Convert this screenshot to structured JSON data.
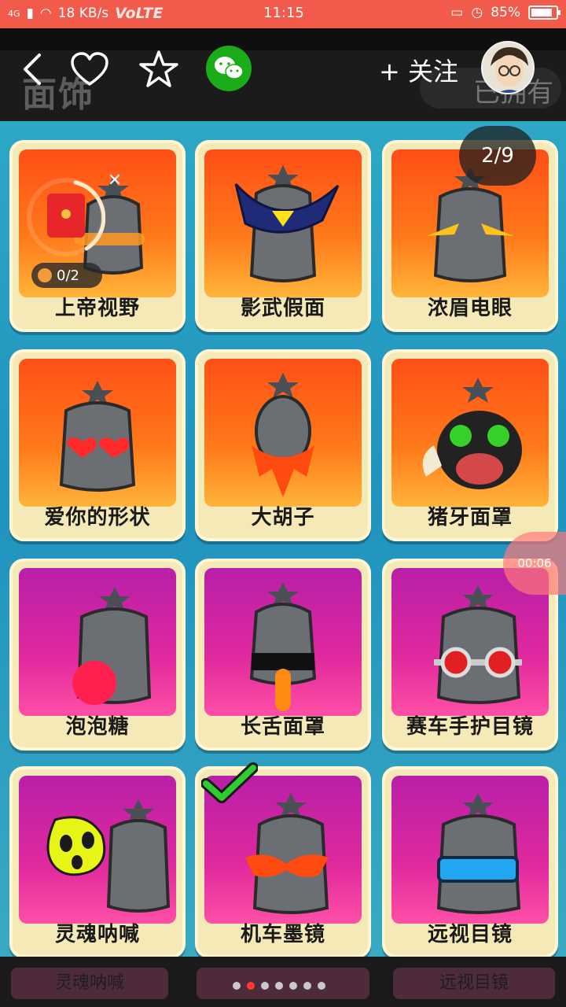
{
  "status_bar": {
    "network": "4G",
    "speed": "18 KB/s",
    "volte": "VoLTE",
    "time": "11:15",
    "battery": "85%"
  },
  "header": {
    "blurred_title": "面饰",
    "blurred_pill": "已拥有",
    "follow_label": "+ 关注"
  },
  "page_badge": "2/9",
  "timer": "00:06",
  "redpacket": {
    "counter": "0/2"
  },
  "items": [
    {
      "label": "上帝视野",
      "theme": "orange"
    },
    {
      "label": "影武假面",
      "theme": "orange"
    },
    {
      "label": "浓眉电眼",
      "theme": "orange"
    },
    {
      "label": "爱你的形状",
      "theme": "orange"
    },
    {
      "label": "大胡子",
      "theme": "orange"
    },
    {
      "label": "猪牙面罩",
      "theme": "orange"
    },
    {
      "label": "泡泡糖",
      "theme": "pink"
    },
    {
      "label": "长舌面罩",
      "theme": "pink"
    },
    {
      "label": "赛车手护目镜",
      "theme": "pink"
    },
    {
      "label": "灵魂呐喊",
      "theme": "pink"
    },
    {
      "label": "机车墨镜",
      "theme": "pink",
      "selected": true
    },
    {
      "label": "远视目镜",
      "theme": "pink"
    }
  ],
  "bottom": {
    "ghost_left": "灵魂呐喊",
    "ghost_right": "远视目镜"
  },
  "pagination": {
    "count": 7,
    "active_index": 1
  },
  "colors": {
    "status_bar": "#f25b4c",
    "wechat": "#1aad19",
    "accent": "#ff3b30"
  }
}
